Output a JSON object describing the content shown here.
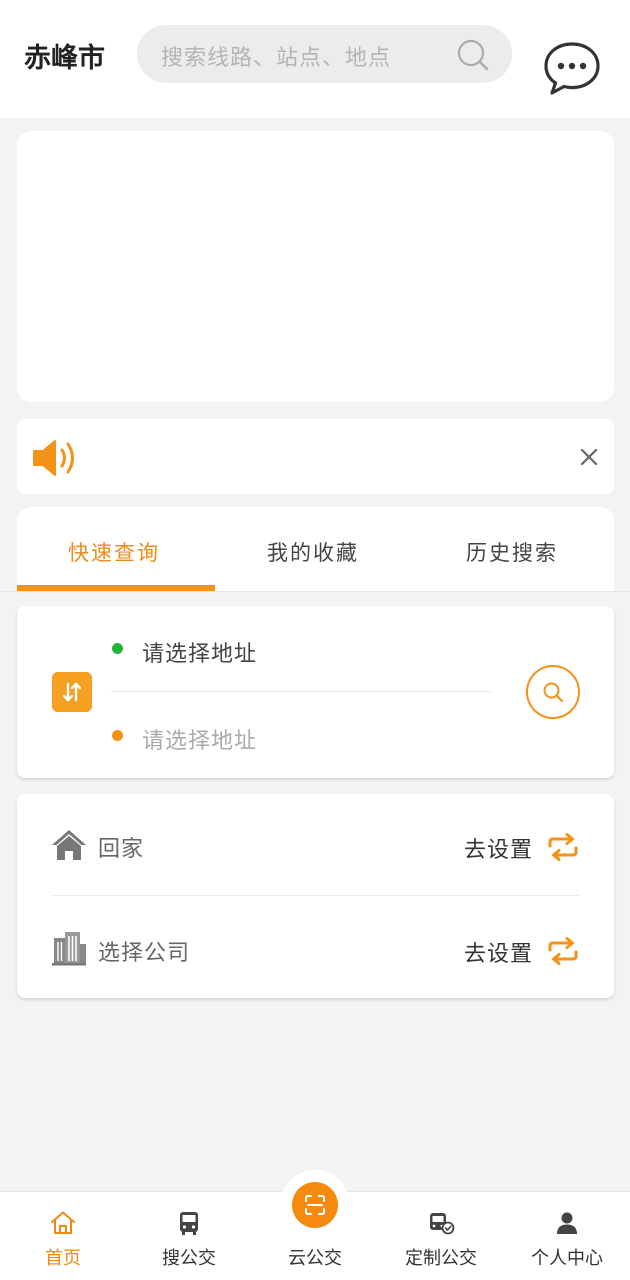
{
  "header": {
    "city": "赤峰市",
    "search_placeholder": "搜索线路、站点、地点",
    "icons": [
      "search-icon",
      "message-icon"
    ]
  },
  "notice": {
    "icons": [
      "speaker-icon",
      "close-icon"
    ]
  },
  "tabs": [
    {
      "label": "快速查询",
      "active": true
    },
    {
      "label": "我的收藏",
      "active": false
    },
    {
      "label": "历史搜索",
      "active": false
    }
  ],
  "route": {
    "from_placeholder": "请选择地址",
    "to_placeholder": "请选择地址"
  },
  "favorites": [
    {
      "label": "回家",
      "action": "去设置",
      "icon": "home-icon"
    },
    {
      "label": "选择公司",
      "action": "去设置",
      "icon": "building-icon"
    }
  ],
  "bottom_nav": [
    {
      "label": "首页",
      "icon": "home-icon",
      "active": true
    },
    {
      "label": "搜公交",
      "icon": "bus-icon",
      "active": false
    },
    {
      "label": "云公交",
      "icon": "scan-icon",
      "active": false
    },
    {
      "label": "定制公交",
      "icon": "custom-bus-icon",
      "active": false
    },
    {
      "label": "个人中心",
      "icon": "user-icon",
      "active": false
    }
  ],
  "colors": {
    "accent": "#f39217",
    "active_text": "#ee8a16",
    "origin_dot": "#22b33a",
    "background": "#f3f3f3"
  }
}
